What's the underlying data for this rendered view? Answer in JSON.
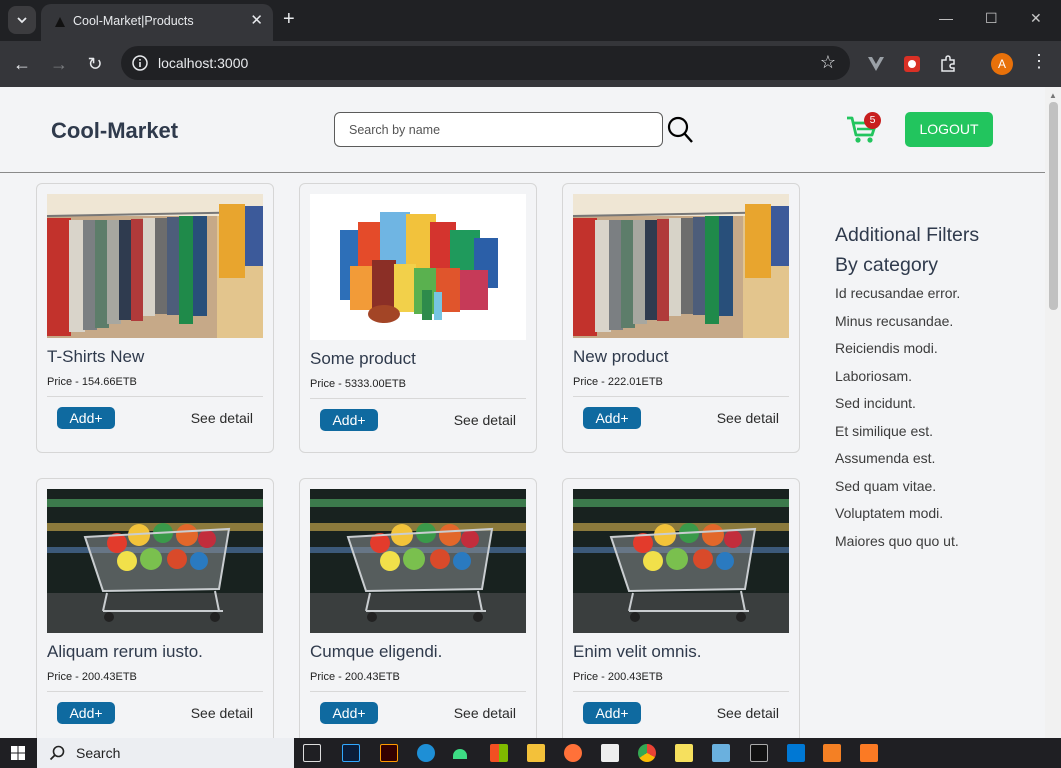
{
  "browser": {
    "tab_title": "Cool-Market|Products",
    "tab_close": "✕",
    "new_tab": "+",
    "url": "localhost:3000",
    "profile_initial": "A",
    "window_controls": {
      "minimize": "—",
      "maximize": "☐",
      "close": "✕"
    }
  },
  "header": {
    "brand": "Cool-Market",
    "search_placeholder": "Search by name",
    "cart_count": "5",
    "logout_label": "LOGOUT"
  },
  "products": [
    {
      "title": "T-Shirts New",
      "price": "Price - 154.66ETB",
      "add_label": "Add+",
      "detail_label": "See detail",
      "image": "clothes-rack"
    },
    {
      "title": "Some product",
      "price": "Price - 5333.00ETB",
      "add_label": "Add+",
      "detail_label": "See detail",
      "image": "grocery-packs"
    },
    {
      "title": "New product",
      "price": "Price - 222.01ETB",
      "add_label": "Add+",
      "detail_label": "See detail",
      "image": "clothes-rack"
    },
    {
      "title": "Aliquam rerum iusto.",
      "price": "Price - 200.43ETB",
      "add_label": "Add+",
      "detail_label": "See detail",
      "image": "shopping-cart"
    },
    {
      "title": "Cumque eligendi.",
      "price": "Price - 200.43ETB",
      "add_label": "Add+",
      "detail_label": "See detail",
      "image": "shopping-cart"
    },
    {
      "title": "Enim velit omnis.",
      "price": "Price - 200.43ETB",
      "add_label": "Add+",
      "detail_label": "See detail",
      "image": "shopping-cart"
    }
  ],
  "filters": {
    "heading": "Additional Filters",
    "subheading": "By category",
    "categories": [
      "Id recusandae error.",
      "Minus recusandae.",
      "Reiciendis modi.",
      "Laboriosam.",
      "Sed incidunt.",
      "Et similique est.",
      "Assumenda est.",
      "Sed quam vitae.",
      "Voluptatem modi.",
      "Maiores quo quo ut."
    ]
  },
  "taskbar": {
    "search_label": "Search"
  },
  "colors": {
    "accent_green": "#22c55e",
    "add_button": "#0f6aa0",
    "badge_red": "#c81e1e",
    "brand_text": "#2f3a4c"
  }
}
